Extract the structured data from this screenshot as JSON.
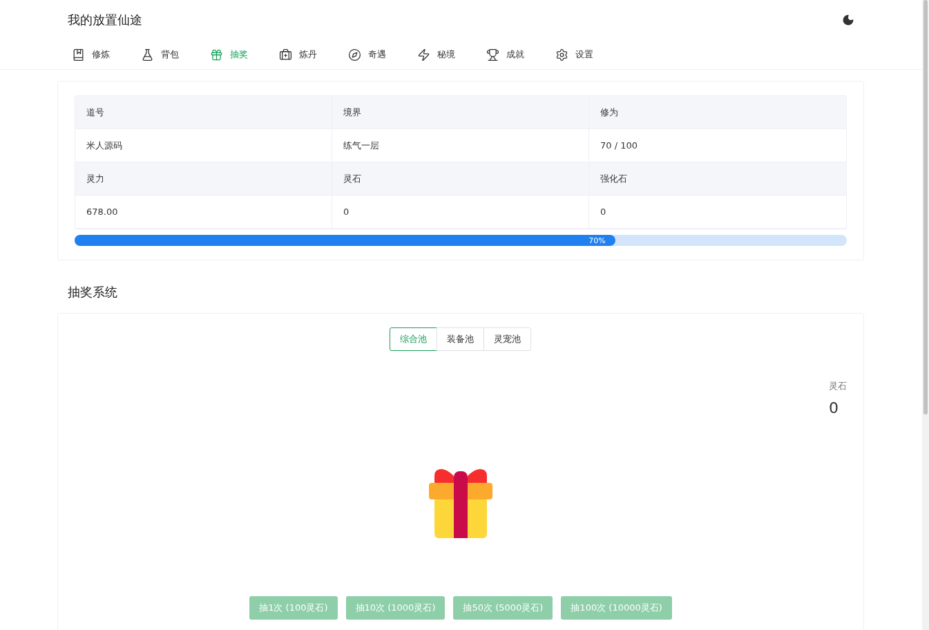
{
  "header": {
    "title": "我的放置仙途"
  },
  "nav": [
    {
      "label": "修炼",
      "selected": false
    },
    {
      "label": "背包",
      "selected": false
    },
    {
      "label": "抽奖",
      "selected": true
    },
    {
      "label": "炼丹",
      "selected": false
    },
    {
      "label": "奇遇",
      "selected": false
    },
    {
      "label": "秘境",
      "selected": false
    },
    {
      "label": "成就",
      "selected": false
    },
    {
      "label": "设置",
      "selected": false
    }
  ],
  "stats": {
    "rows": [
      {
        "kind": "head",
        "cells": [
          "道号",
          "境界",
          "修为"
        ]
      },
      {
        "kind": "value",
        "cells": [
          "米人源码",
          "练气一层",
          "70 / 100"
        ]
      },
      {
        "kind": "head",
        "cells": [
          "灵力",
          "灵石",
          "强化石"
        ]
      },
      {
        "kind": "value",
        "cells": [
          "678.00",
          "0",
          "0"
        ]
      }
    ],
    "progress": {
      "level": 0.7,
      "label": "70%"
    }
  },
  "lottery": {
    "title": "抽奖系统",
    "pools": [
      {
        "label": "综合池",
        "selected": true
      },
      {
        "label": "装备池",
        "selected": false
      },
      {
        "label": "灵宠池",
        "selected": false
      }
    ],
    "balance": {
      "label": "灵石",
      "value": "0"
    },
    "buttons": [
      {
        "label": "抽1次 (100灵石)",
        "disabled": true
      },
      {
        "label": "抽10次 (1000灵石)",
        "disabled": true
      },
      {
        "label": "抽50次 (5000灵石)",
        "disabled": true
      },
      {
        "label": "抽100次 (10000灵石)",
        "disabled": true
      }
    ]
  }
}
